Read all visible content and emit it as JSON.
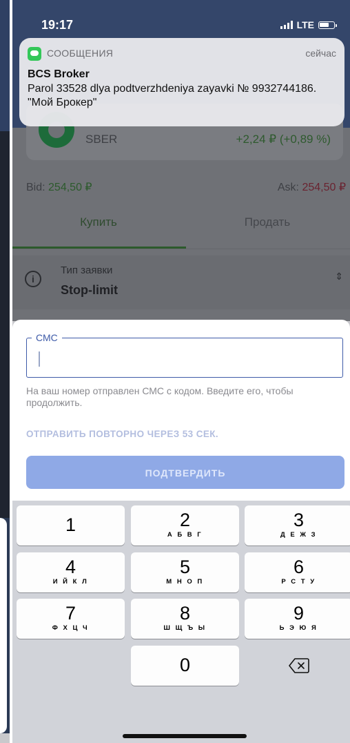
{
  "status_bar": {
    "time": "19:17",
    "network": "LTE"
  },
  "notification": {
    "app": "СООБЩЕНИЯ",
    "time": "сейчас",
    "sender": "BCS Broker",
    "message": "Parol 33528 dlya podtverzhdeniya zayavki № 9932744186. \"Мой Брокер\""
  },
  "ticker": {
    "name": "SBER",
    "change": "+2,24 ₽ (+0,89 %)"
  },
  "quotes": {
    "bid_label": "Bid:",
    "bid_value": "254,50 ₽",
    "ask_label": "Ask:",
    "ask_value": "254,50 ₽"
  },
  "tabs": {
    "buy": "Купить",
    "sell": "Продать"
  },
  "order_type": {
    "label": "Тип заявки",
    "value": "Stop-limit"
  },
  "sms": {
    "field_label": "СМС",
    "value": "",
    "hint": "На ваш номер отправлен СМС с кодом. Введите его, чтобы продолжить.",
    "resend": "ОТПРАВИТЬ ПОВТОРНО ЧЕРЕЗ 53 СЕК.",
    "confirm": "ПОДТВЕРДИТЬ"
  },
  "keypad": {
    "keys": [
      {
        "num": "1",
        "letters": ""
      },
      {
        "num": "2",
        "letters": "А Б В Г"
      },
      {
        "num": "3",
        "letters": "Д Е Ж З"
      },
      {
        "num": "4",
        "letters": "И Й К Л"
      },
      {
        "num": "5",
        "letters": "М Н О П"
      },
      {
        "num": "6",
        "letters": "Р С Т У"
      },
      {
        "num": "7",
        "letters": "Ф Х Ц Ч"
      },
      {
        "num": "8",
        "letters": "Ш Щ Ъ Ы"
      },
      {
        "num": "9",
        "letters": "Ь Э Ю Я"
      },
      {
        "num": "0",
        "letters": ""
      }
    ],
    "delete_icon": "backspace-icon"
  },
  "colors": {
    "accent": "#3d5aa8",
    "confirm_bg": "#8fa9e6",
    "buy": "#2c5a2c",
    "ask": "#6a2330"
  }
}
